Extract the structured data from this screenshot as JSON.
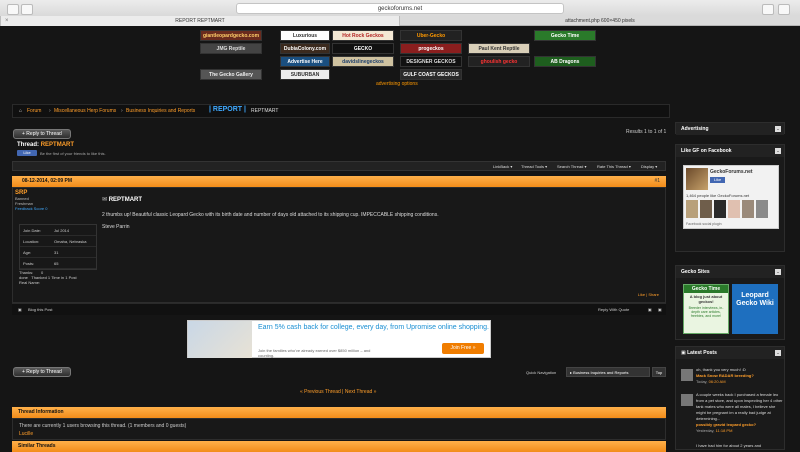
{
  "browser": {
    "url": "geckoforums.net",
    "tabs": [
      "REPORT REPTMART",
      "attachment.php 600×450 pixels"
    ]
  },
  "banners": [
    {
      "label": "giantleopardgecko.com",
      "bg": "#6a2b1e",
      "fg": "#ffcf6a"
    },
    {
      "label": "Luxurious Leopards",
      "bg": "#ffffff",
      "fg": "#333333"
    },
    {
      "label": "Hot Rock Geckos",
      "bg": "#f3e7d3",
      "fg": "#b22222"
    },
    {
      "label": "Uber-Gecko",
      "bg": "#222222",
      "fg": "#ff9900"
    },
    {
      "label": "Gecko Time",
      "bg": "#2a7a2a",
      "fg": "#ffffff"
    },
    {
      "label": "JMG Reptile",
      "bg": "#444444",
      "fg": "#dddddd"
    },
    {
      "label": "DubiaColony.com",
      "bg": "#3b2a1e",
      "fg": "#ffffff"
    },
    {
      "label": "GECKO",
      "bg": "#111111",
      "fg": "#ffffff"
    },
    {
      "label": "progeckos",
      "bg": "#8a1e1e",
      "fg": "#ffffff"
    },
    {
      "label": "Paul Kent Reptile",
      "bg": "#d9cfb8",
      "fg": "#333333"
    },
    {
      "label": "Advertise Here",
      "bg": "#1a4f80",
      "fg": "#ffffff"
    },
    {
      "label": "davidslinegeckos",
      "bg": "#cfc2a0",
      "fg": "#1e3f6b"
    },
    {
      "label": "DESIGNER GECKOS",
      "bg": "#111111",
      "fg": "#dddddd"
    },
    {
      "label": "ghoulish gecko",
      "bg": "#222222",
      "fg": "#ff3333"
    },
    {
      "label": "AB Dragons",
      "bg": "#1e5e1e",
      "fg": "#ffffff"
    },
    {
      "label": "SUBURBAN GECKOS",
      "bg": "#eeeeee",
      "fg": "#333333"
    },
    {
      "label": "GULF COAST GECKOS",
      "bg": "#2a2a2a",
      "fg": "#ffffff"
    },
    {
      "label": "The Gecko Gallery",
      "bg": "#555555",
      "fg": "#eeeeee"
    }
  ],
  "advertising_options": "advertising options",
  "breadcrumb": {
    "items": [
      "Forum",
      "Miscellaneous Herp Forums",
      "Business Inquiries and Reports"
    ],
    "current": "| REPORT |",
    "current_sub": "REPTMART"
  },
  "reply_label": "+ Reply to Thread",
  "thread": {
    "label": "Thread:",
    "title": "REPTMART",
    "fb_like": "Like",
    "fb_text": "Be the first of your friends to like this.",
    "results": "Results 1 to 1 of 1"
  },
  "tools": [
    "LinkBack ▾",
    "Thread Tools ▾",
    "Search Thread ▾",
    "Rate This Thread ▾",
    "Display ▾"
  ],
  "post": {
    "date": "08-12-2014, 02:09 PM",
    "number": "#1",
    "username": "SRP",
    "status_lines": [
      "Banned",
      "Freshman",
      "Feedback Score 0"
    ],
    "info": [
      {
        "k": "Join Date:",
        "v": "Jul 2014"
      },
      {
        "k": "Location:",
        "v": "Omaha, Nebraska"
      },
      {
        "k": "Age:",
        "v": "31"
      },
      {
        "k": "Posts:",
        "v": "65"
      }
    ],
    "thanks": [
      "Thanks:",
      "0",
      "Thanked 1 Time in 1 Post"
    ],
    "thanks2": "done",
    "realname": "Real Name:",
    "title": "REPTMART",
    "body": "2 thumbs up! Beautiful classic Leopard Gecko with its birth date and number of days old attached to its shipping cup. IMPECCABLE shipping conditions.",
    "signature": "Steve Parrin",
    "like": "Like",
    "share": "Share",
    "blog": "Blog this Post",
    "reply_quote": "Reply With Quote"
  },
  "ad": {
    "headline": "Earn 5% cash back for college, every day, from Upromise online shopping.",
    "sub": "Join the families who've already earned over $850 million – and counting.",
    "button": "Join Free »"
  },
  "quicknav": {
    "label": "Quick Navigation",
    "selected": "▸ Business Inquiries and Reports",
    "top": "Top"
  },
  "prevnext": "« Previous Thread | Next Thread »",
  "thread_info": {
    "heading": "Thread Information",
    "text": "There are currently 1 users browsing this thread. (1 members and 0 guests)",
    "user": "Lucille"
  },
  "similar": "Similar Threads",
  "sidebar": {
    "advertising": "Advertising",
    "gf_facebook": "Like GF on Facebook",
    "fb_page": "GeckoForums.net",
    "fb_like": "Like",
    "fb_count": "1,464 people like GeckoForums.net",
    "fb_plugin": "Facebook social plugin",
    "gecko_sites": "Gecko Sites",
    "gecko_time": "Gecko Time",
    "gecko_time_sub": "A blog just about geckos!",
    "gecko_time_desc": "Breeder interviews, in-depth care articles, freebies, and more!",
    "leopard_wiki": "Leopard Gecko Wiki",
    "latest": "Latest Posts",
    "posts": [
      {
        "text": "oh, thank you very much! :D",
        "title": "Mack Snow RADAR breeding?",
        "date": "Today,",
        "time": "06:20 AM"
      },
      {
        "text": "A couple weeks back I purchased a female leo from a pet store, and upon inspecting her 4 other tank mates who were all males, I believe she might be pregnant im a really bad judge at determining...",
        "title": "possibly gravid leopard gecko?",
        "date": "Yesterday,",
        "time": "11:18 PM"
      },
      {
        "text": "I have had him for about 2 years and",
        "title": "",
        "date": "",
        "time": ""
      }
    ]
  },
  "colors": {
    "accent": "#ff9e2a",
    "link_blue": "#3fa9ff",
    "header_orange": "#f28c1a"
  }
}
